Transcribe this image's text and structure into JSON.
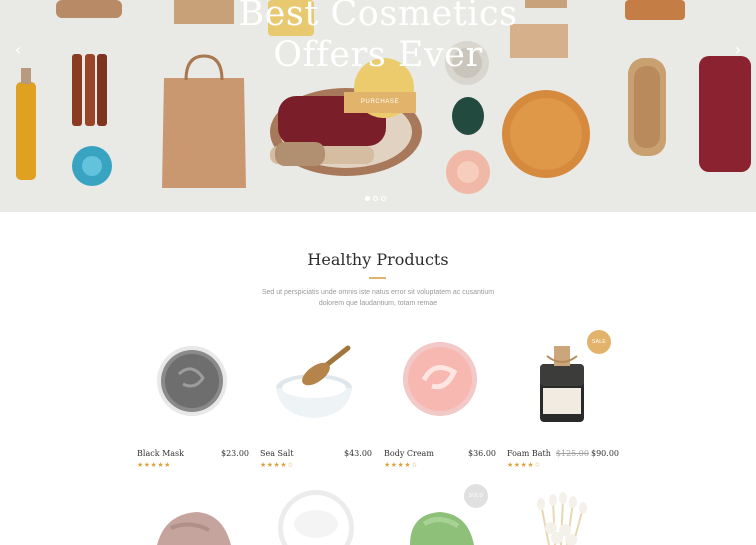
{
  "hero": {
    "title_line1": "Best Cosmetics",
    "title_line2": "Offers Ever",
    "button_label": "PURCHASE",
    "prev_arrow": "‹",
    "next_arrow": "›",
    "slides": 3,
    "active_slide": 1
  },
  "section": {
    "title": "Healthy Products",
    "description": "Sed ut perspiciatis unde omnis iste natus error sit voluptatem ac cusantium dolorem que laudantium, totam remae"
  },
  "colors": {
    "accent": "#e2b36a",
    "star": "#d9a544",
    "sold_badge": "#e0e0e0"
  },
  "products": [
    {
      "name": "Black Mask",
      "price": "$23.00",
      "stars": "★★★★★",
      "rating": 5
    },
    {
      "name": "Sea Salt",
      "price": "$43.00",
      "stars": "★★★★☆",
      "rating": 4
    },
    {
      "name": "Body Cream",
      "price": "$36.00",
      "stars": "★★★★☆",
      "rating": 4
    },
    {
      "name": "Foam Bath",
      "old_price": "$125.00",
      "price": "$90.00",
      "stars": "★★★★☆",
      "rating": 4,
      "badge": "SALE"
    }
  ],
  "products_row2": [
    {
      "icon": "clay-powder-icon"
    },
    {
      "icon": "cream-bowl-icon"
    },
    {
      "icon": "green-mask-icon",
      "badge": "SOLD"
    },
    {
      "icon": "cotton-swabs-icon"
    }
  ]
}
